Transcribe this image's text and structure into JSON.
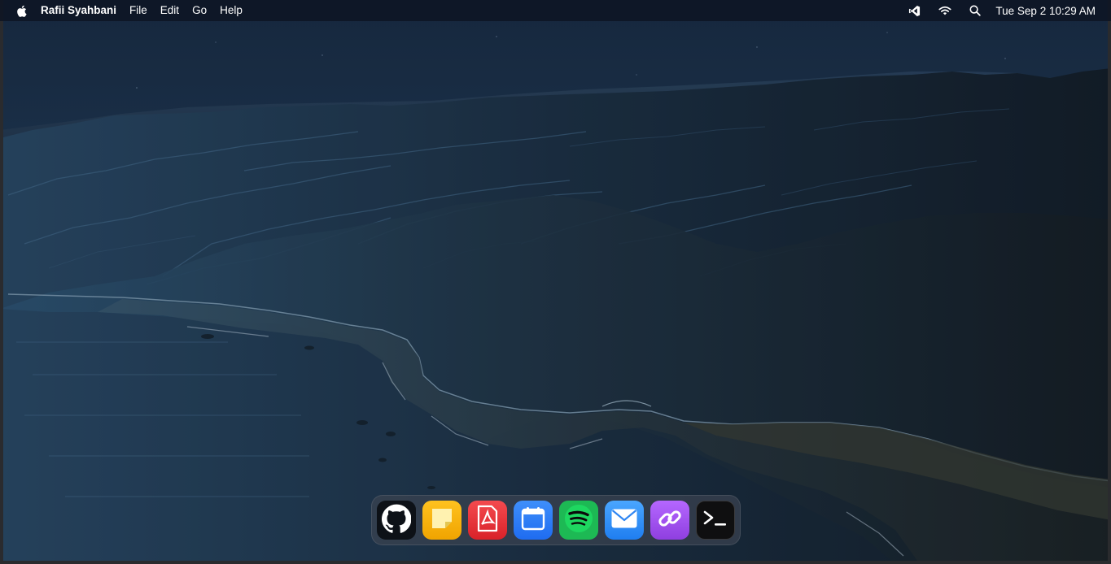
{
  "menubar": {
    "apple_icon": "apple-logo-icon",
    "app_name": "Rafii Syahbani",
    "menus": [
      "File",
      "Edit",
      "Go",
      "Help"
    ],
    "status_icons": [
      "vscode-icon",
      "wifi-icon",
      "search-icon"
    ],
    "clock": "Tue Sep 2 10:29 AM"
  },
  "dock": {
    "apps": [
      {
        "icon": "github-icon",
        "color": "#0d1117"
      },
      {
        "icon": "notes-icon",
        "color": "#f5b400"
      },
      {
        "icon": "pdf-icon",
        "color": "#e8333a"
      },
      {
        "icon": "calendar-icon",
        "color": "#2b7cf6"
      },
      {
        "icon": "spotify-icon",
        "color": "#1db954"
      },
      {
        "icon": "mail-icon",
        "color": "#2f8ef5"
      },
      {
        "icon": "link-icon",
        "color": "#a44ff0"
      },
      {
        "icon": "terminal-icon",
        "color": "#111111"
      }
    ]
  },
  "wallpaper": {
    "description_icon": "mountain-coast-wallpaper",
    "sky_color": "#1b2f47",
    "sea_color": "#1f4466"
  }
}
